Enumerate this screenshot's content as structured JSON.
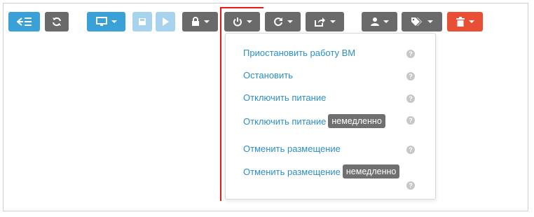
{
  "toolbar": {
    "buttons": [
      {
        "name": "back-to-list-button",
        "icon": "back-list-icon",
        "color": "#3aa0d8"
      },
      {
        "name": "refresh-button",
        "icon": "refresh-icon",
        "color": "#6a6a6a"
      },
      {
        "name": "vnc-console-button",
        "icon": "monitor-icon",
        "color": "#3aa0d8"
      },
      {
        "name": "save-button",
        "icon": "save-icon",
        "color": "#a8d3ee",
        "disabled": true
      },
      {
        "name": "play-button",
        "icon": "play-icon",
        "color": "#a8d3ee",
        "disabled": true
      },
      {
        "name": "lock-button",
        "icon": "lock-icon",
        "color": "#6a6a6a"
      },
      {
        "name": "power-button",
        "icon": "power-icon",
        "color": "#6a6a6a"
      },
      {
        "name": "reboot-button",
        "icon": "reboot-icon",
        "color": "#6a6a6a"
      },
      {
        "name": "share-button",
        "icon": "share-icon",
        "color": "#6a6a6a"
      },
      {
        "name": "user-button",
        "icon": "user-icon",
        "color": "#6a6a6a"
      },
      {
        "name": "tags-button",
        "icon": "tags-icon",
        "color": "#6a6a6a"
      },
      {
        "name": "delete-button",
        "icon": "trash-icon",
        "color": "#e94f35"
      }
    ]
  },
  "power_menu": {
    "items": [
      {
        "label": "Приостановить работу ВМ",
        "badge": null
      },
      {
        "label": "Остановить",
        "badge": null
      },
      {
        "label": "Отключить питание",
        "badge": null
      },
      {
        "label": "Отключить питание",
        "badge": "немедленно"
      },
      {
        "label": "Отменить размещение",
        "badge": null
      },
      {
        "label": "Отменить размещение",
        "badge": "немедленно"
      }
    ],
    "help_icon": "question-circle-icon"
  },
  "colors": {
    "link": "#2b8fc9",
    "annotation": "#e31b1b"
  }
}
